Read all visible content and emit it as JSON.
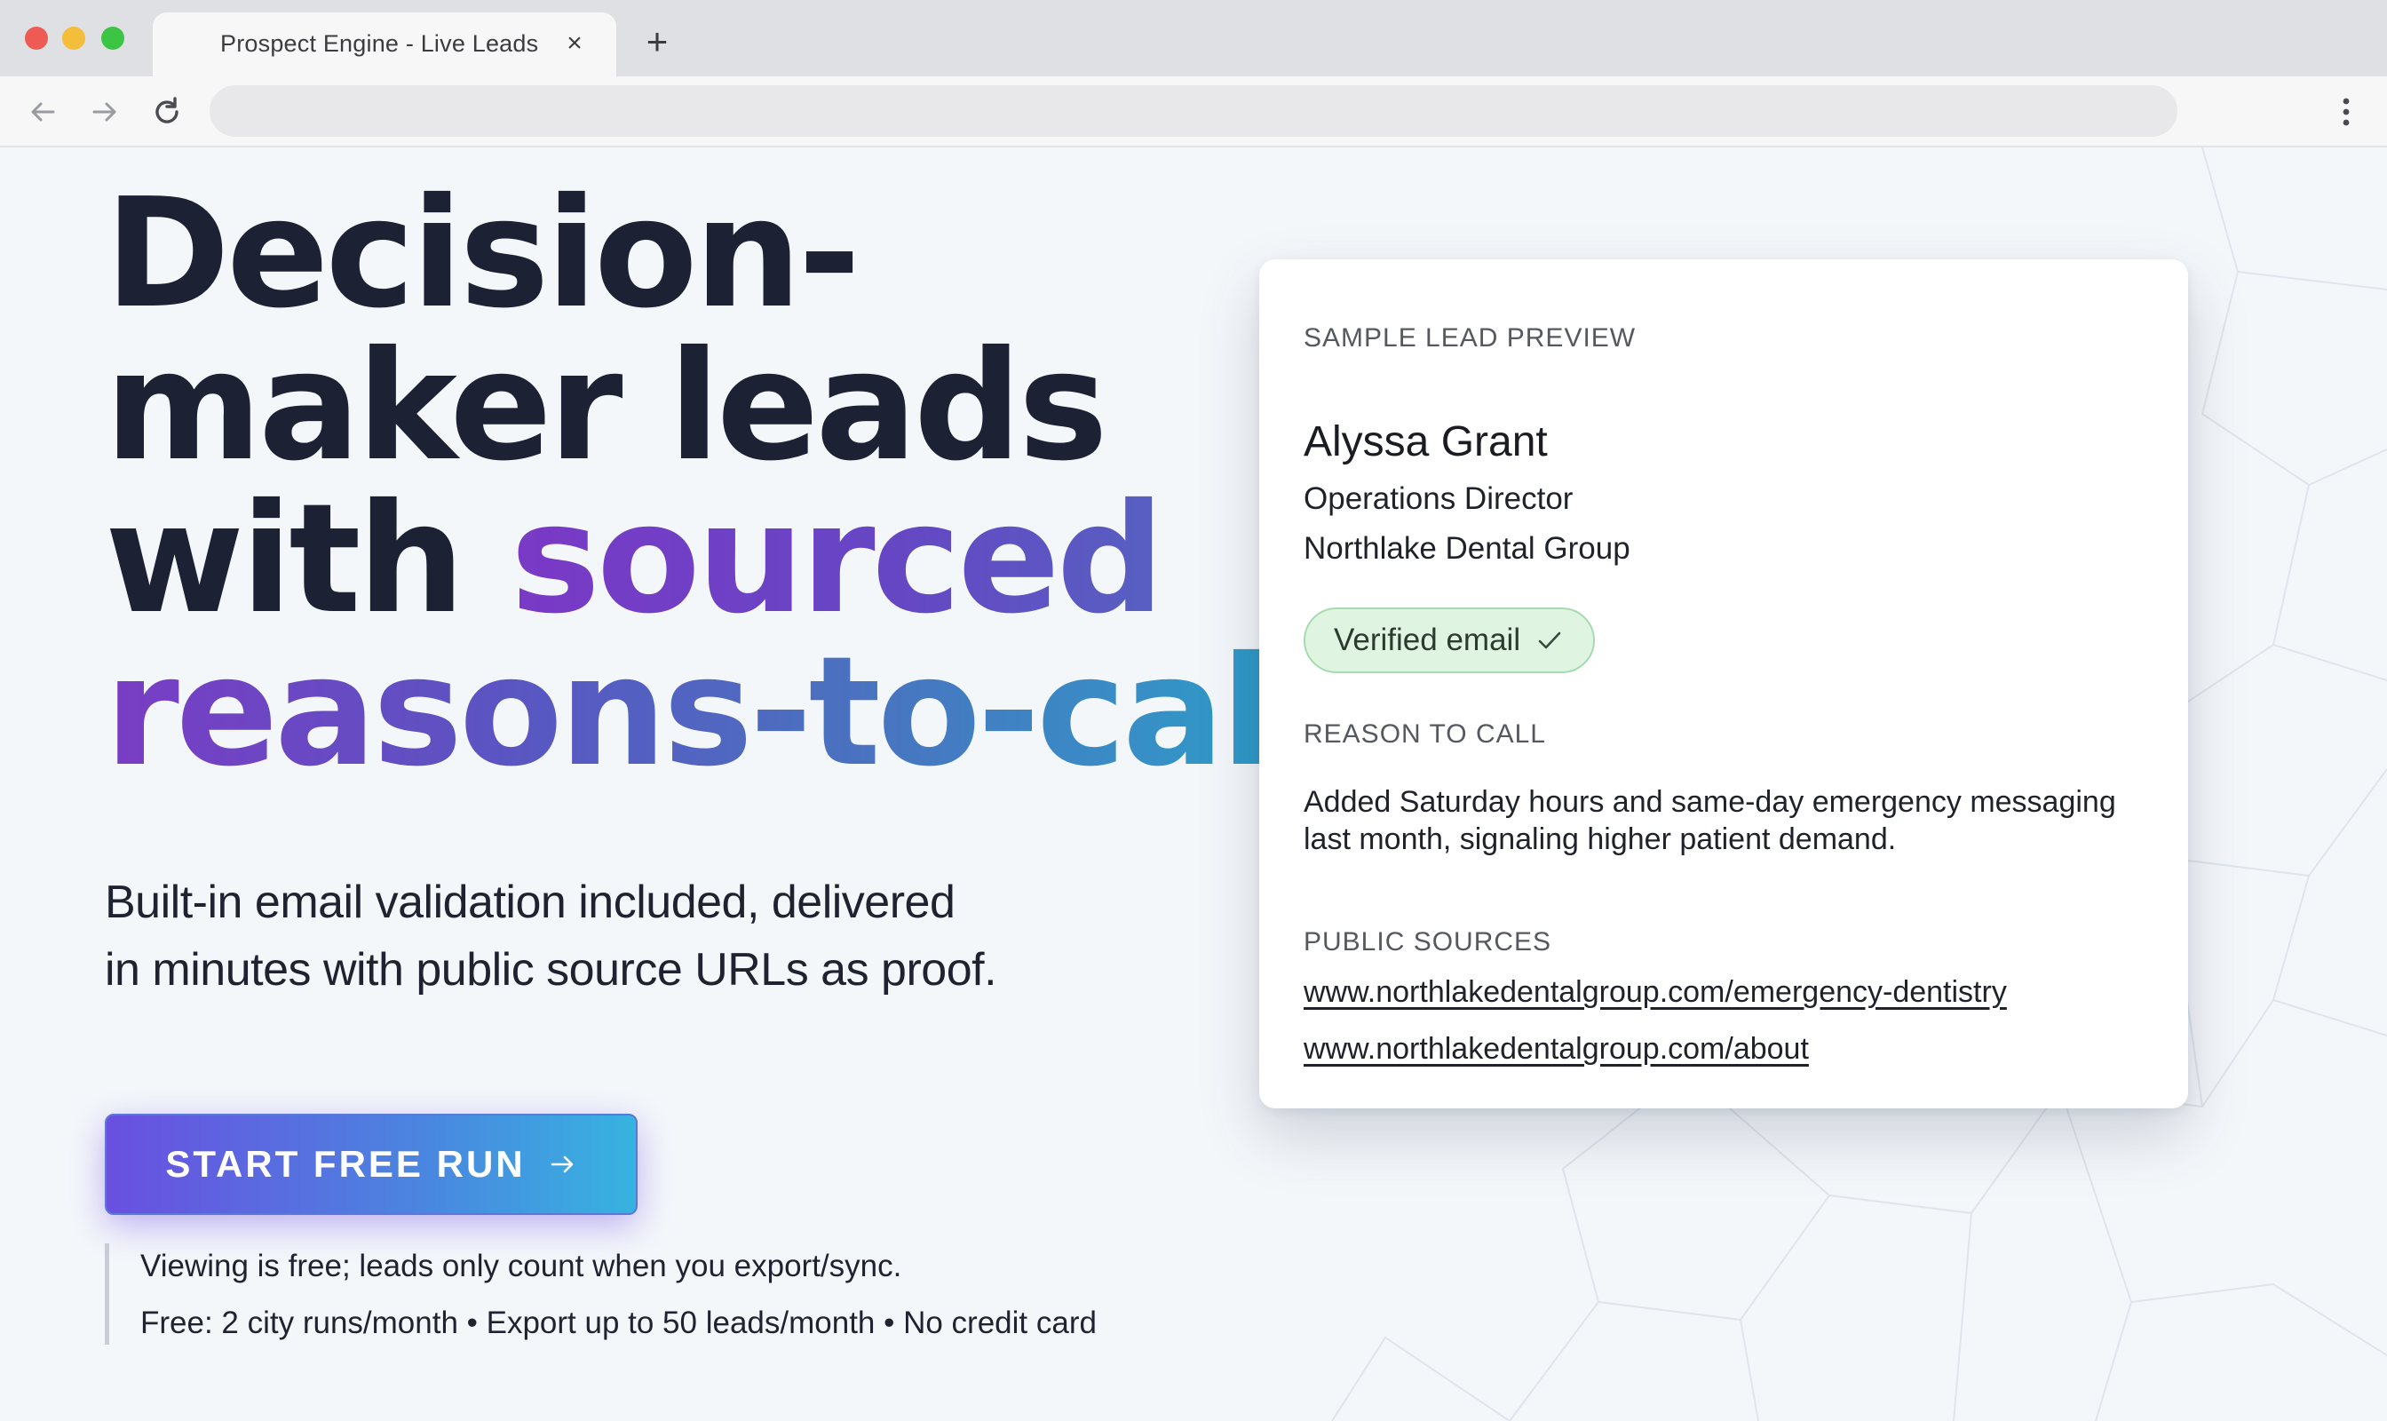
{
  "browser": {
    "tab_title": "Prospect Engine - Live Leads",
    "tab_close_glyph": "×",
    "new_tab_glyph": "+",
    "icons": [
      "back-arrow-icon",
      "forward-arrow-icon",
      "reload-icon",
      "kebab-menu-icon"
    ]
  },
  "hero": {
    "title_line1": "Decision-",
    "title_line2": "maker leads",
    "title_line3_plain": "with ",
    "title_line3_accent": "sourced",
    "title_line4_accent": "reasons-to-call",
    "subtitle_line1": "Built-in email validation included, delivered",
    "subtitle_line2": "in minutes with public source URLs as proof.",
    "cta_label": "START FREE RUN",
    "note_1": "Viewing is free; leads only count when you export/sync.",
    "note_2": "Free: 2 city runs/month • Export up to 50 leads/month • No credit card"
  },
  "lead_card": {
    "header": "SAMPLE LEAD PREVIEW",
    "name": "Alyssa Grant",
    "role": "Operations Director",
    "company": "Northlake Dental Group",
    "badge": "Verified email",
    "reason_header": "REASON TO CALL",
    "reason": "Added Saturday hours and same-day emergency messaging last month, signaling higher patient demand.",
    "sources_header": "PUBLIC SOURCES",
    "sources": [
      "www.northlakedentalgroup.com/emergency-dentistry",
      "www.northlakedentalgroup.com/about"
    ]
  },
  "colors": {
    "heading": "#1c2133",
    "accent_start": "#7a3cc4",
    "accent_end": "#2f9bc8",
    "verified_bg": "#dff5e2"
  }
}
